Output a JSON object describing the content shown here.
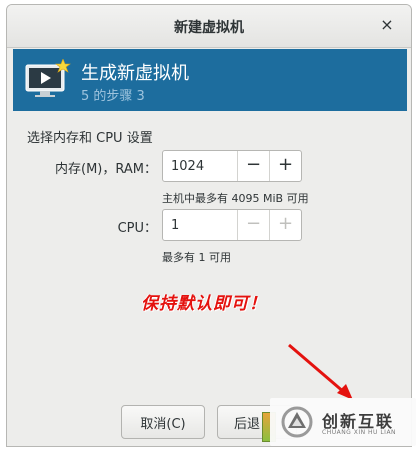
{
  "window": {
    "title": "新建虚拟机",
    "close_glyph": "×"
  },
  "header": {
    "title": "生成新虚拟机",
    "step": "5 的步骤 3",
    "icon": "vm-monitor-icon"
  },
  "memory_section": {
    "heading": "选择内存和 CPU 设置",
    "ram_label": "内存(M)，RAM：",
    "ram_value": "1024",
    "ram_hint": "主机中最多有 4095 MiB 可用",
    "cpu_label": "CPU：",
    "cpu_value": "1",
    "cpu_hint": "最多有 1 可用",
    "minus_glyph": "−",
    "plus_glyph": "+"
  },
  "annotation": {
    "text": "保持默认即可！",
    "color": "#e4120e"
  },
  "footer": {
    "cancel_label": "取消(C)",
    "back_label": "后退"
  },
  "watermark": {
    "text": "创新互联",
    "subtext": "CHUANG XIN HU LIAN"
  },
  "colors": {
    "header_bg": "#1d6d9e",
    "dialog_bg": "#ededeb"
  }
}
